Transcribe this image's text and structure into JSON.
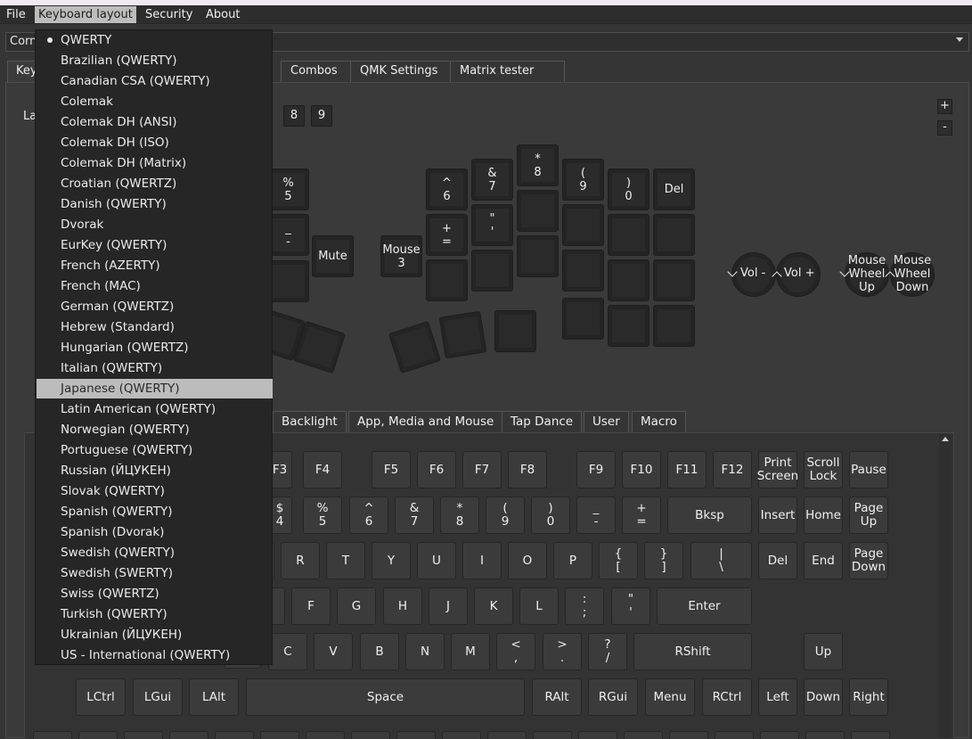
{
  "menubar": {
    "items": [
      "File",
      "Keyboard layout",
      "Security",
      "About"
    ],
    "active_index": 1
  },
  "device_combo": {
    "value_partial": "Corn"
  },
  "top_tabs": {
    "partial_first": "Key",
    "visible": [
      "Combos",
      "QMK Settings",
      "Matrix tester"
    ]
  },
  "layers": {
    "label_partial": "La",
    "visible_buttons": [
      "8",
      "9"
    ],
    "add": "+",
    "remove": "-"
  },
  "keymap": {
    "left_keys": [
      "%\n5",
      "_\n-",
      "Mute",
      "Mouse\n3"
    ],
    "right_keys": [
      "^\n6",
      "&\n7",
      "*\n8",
      "(\n9",
      ")\n0",
      "Del",
      "+\n=",
      "\"\n'"
    ],
    "encoders": {
      "vol_down": "Vol -",
      "vol_up": "Vol +",
      "wheel_up": "Mouse\nWheel\nUp",
      "wheel_down": "Mouse\nWheel\nDown"
    }
  },
  "bottom_tabs": [
    "Backlight",
    "App, Media and Mouse",
    "Tap Dance",
    "User",
    "Macro"
  ],
  "keyboard": {
    "row_f": [
      "F3",
      "F4",
      "F5",
      "F6",
      "F7",
      "F8",
      "F9",
      "F10",
      "F11",
      "F12",
      "Print\nScreen",
      "Scroll\nLock",
      "Pause"
    ],
    "row_num": [
      "$\n4",
      "%\n5",
      "^\n6",
      "&\n7",
      "*\n8",
      "(\n9",
      ")\n0",
      "_\n-",
      "+\n=",
      "Bksp",
      "Insert",
      "Home",
      "Page\nUp"
    ],
    "row_top": [
      "R",
      "T",
      "Y",
      "U",
      "I",
      "O",
      "P",
      "{\n[",
      "}\n]",
      "|\n\\",
      "Del",
      "End",
      "Page\nDown"
    ],
    "row_home": [
      "F",
      "G",
      "H",
      "J",
      "K",
      "L",
      ":\n;",
      "\"\n'",
      "Enter"
    ],
    "row_bottom": [
      "C",
      "V",
      "B",
      "N",
      "M",
      "<\n,",
      ">\n.",
      "?\n/",
      "RShift",
      "Up"
    ],
    "row_mod": [
      "LCtrl",
      "LGui",
      "LAlt",
      "Space",
      "RAlt",
      "RGui",
      "Menu",
      "RCtrl",
      "Left",
      "Down",
      "Right"
    ]
  },
  "layout_menu": {
    "selected": "QWERTY",
    "highlighted": "Japanese (QWERTY)",
    "items": [
      "QWERTY",
      "Brazilian (QWERTY)",
      "Canadian CSA (QWERTY)",
      "Colemak",
      "Colemak DH (ANSI)",
      "Colemak DH (ISO)",
      "Colemak DH (Matrix)",
      "Croatian (QWERTZ)",
      "Danish (QWERTY)",
      "Dvorak",
      "EurKey (QWERTY)",
      "French (AZERTY)",
      "French (MAC)",
      "German (QWERTZ)",
      "Hebrew (Standard)",
      "Hungarian (QWERTZ)",
      "Italian (QWERTY)",
      "Japanese (QWERTY)",
      "Latin American (QWERTY)",
      "Norwegian (QWERTY)",
      "Portuguese (QWERTY)",
      "Russian (ЙЦУКЕН)",
      "Slovak (QWERTY)",
      "Spanish (QWERTY)",
      "Spanish (Dvorak)",
      "Swedish (QWERTY)",
      "Swedish (SWERTY)",
      "Swiss (QWERTZ)",
      "Turkish (QWERTY)",
      "Ukrainian (ЙЦУКЕН)",
      "US - International (QWERTY)"
    ]
  }
}
